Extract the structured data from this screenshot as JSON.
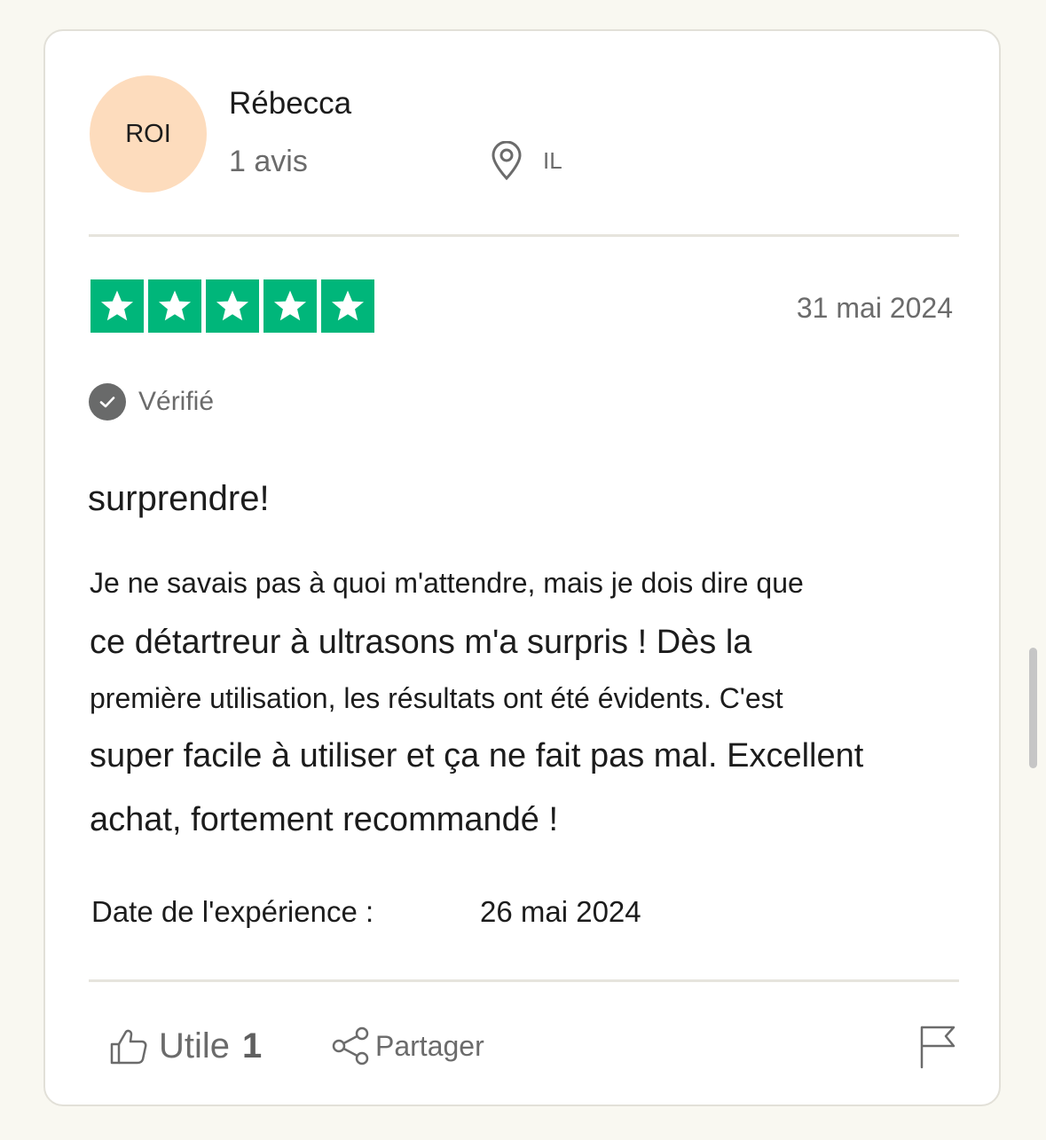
{
  "reviewer": {
    "initials": "ROI",
    "name": "Rébecca",
    "review_count": "1 avis",
    "location": "IL",
    "avatar_color": "#fddcbd"
  },
  "review": {
    "rating": 5,
    "rating_max": 5,
    "star_color": "#00b67a",
    "date": "31 mai 2024",
    "verified_label": "Vérifié",
    "title": "surprendre!",
    "body_lines": [
      "Je ne savais pas à quoi m'attendre, mais je dois dire que",
      "ce détartreur à ultrasons m'a surpris ! Dès la",
      "première utilisation, les résultats ont été évidents. C'est",
      "super facile à utiliser et ça ne fait pas mal. Excellent",
      "achat, fortement recommandé !"
    ],
    "experience_label": "Date de l'expérience :",
    "experience_date": "26 mai 2024"
  },
  "actions": {
    "useful_label": "Utile",
    "useful_count": "1",
    "share_label": "Partager",
    "like_icon": "thumbs-up-icon",
    "share_icon": "share-icon",
    "flag_icon": "flag-icon"
  }
}
